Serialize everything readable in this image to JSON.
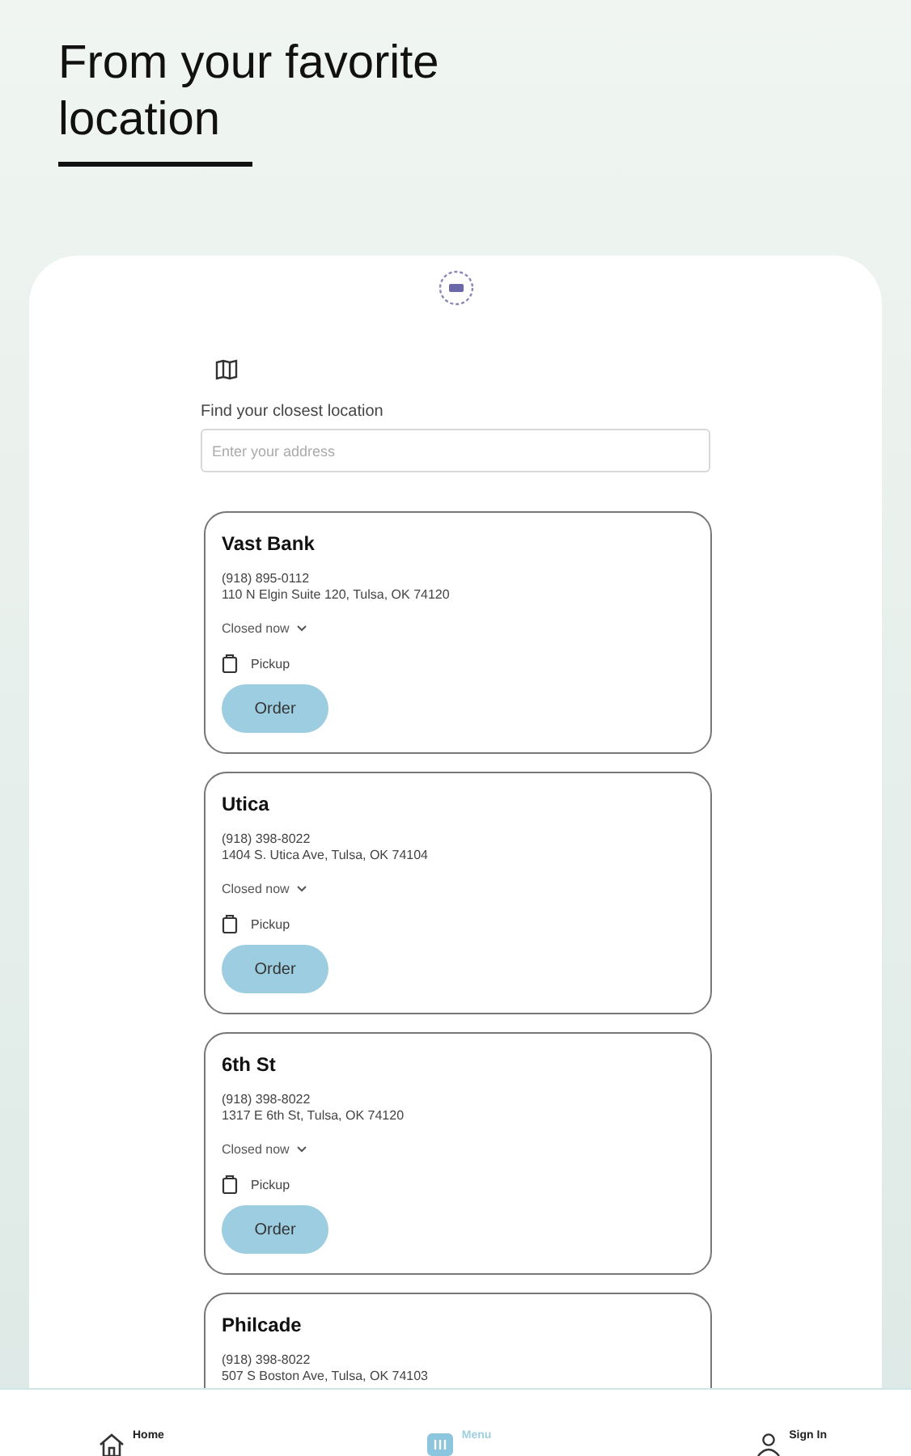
{
  "headline": "From your favorite location",
  "finder": {
    "label": "Find your closest location",
    "placeholder": "Enter your address"
  },
  "locations": [
    {
      "name": "Vast Bank",
      "phone": "(918) 895-0112",
      "address": "110 N Elgin Suite 120, Tulsa, OK 74120",
      "hours": "Closed now",
      "service": "Pickup",
      "action": "Order"
    },
    {
      "name": "Utica",
      "phone": "(918) 398-8022",
      "address": "1404 S. Utica Ave, Tulsa, OK 74104",
      "hours": "Closed now",
      "service": "Pickup",
      "action": "Order"
    },
    {
      "name": "6th St",
      "phone": "(918) 398-8022",
      "address": "1317 E 6th St, Tulsa, OK 74120",
      "hours": "Closed now",
      "service": "Pickup",
      "action": "Order"
    },
    {
      "name": "Philcade",
      "phone": "(918) 398-8022",
      "address": "507 S Boston Ave, Tulsa, OK 74103"
    }
  ],
  "nav": [
    {
      "label": "Home",
      "kind": "home",
      "selected": false
    },
    {
      "label": "Menu",
      "kind": "menu",
      "selected": true
    },
    {
      "label": "Sign In",
      "kind": "user",
      "selected": false
    }
  ]
}
